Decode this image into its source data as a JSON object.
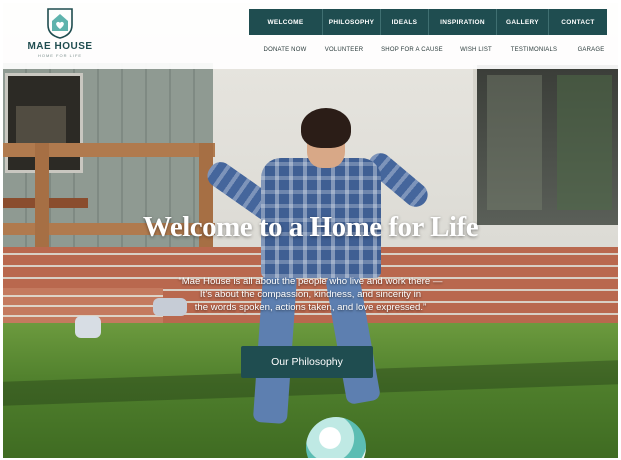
{
  "brand": {
    "name": "MAE HOUSE",
    "tagline": "HOME FOR LIFE",
    "logo_icon": "house-heart-icon"
  },
  "nav_main": [
    {
      "label": "WELCOME"
    },
    {
      "label": "PHILOSOPHY"
    },
    {
      "label": "IDEALS"
    },
    {
      "label": "INSPIRATION"
    },
    {
      "label": "GALLERY"
    },
    {
      "label": "CONTACT"
    }
  ],
  "nav_secondary": [
    {
      "label": "DONATE NOW"
    },
    {
      "label": "VOLUNTEER"
    },
    {
      "label": "SHOP FOR A CAUSE"
    },
    {
      "label": "WISH LIST"
    },
    {
      "label": "TESTIMONIALS"
    },
    {
      "label": "GARAGE"
    }
  ],
  "hero": {
    "title": "Welcome to a Home for Life",
    "quote_lines": [
      "“Mae House is all about the people who live and work there —",
      "It’s about the compassion, kindness, and sincerity in",
      "the words spoken, actions taken, and love expressed.”"
    ],
    "cta_label": "Our Philosophy"
  },
  "colors": {
    "primary": "#1f4d50",
    "nav_text": "#ffffff",
    "header_bg": "#ffffff"
  }
}
